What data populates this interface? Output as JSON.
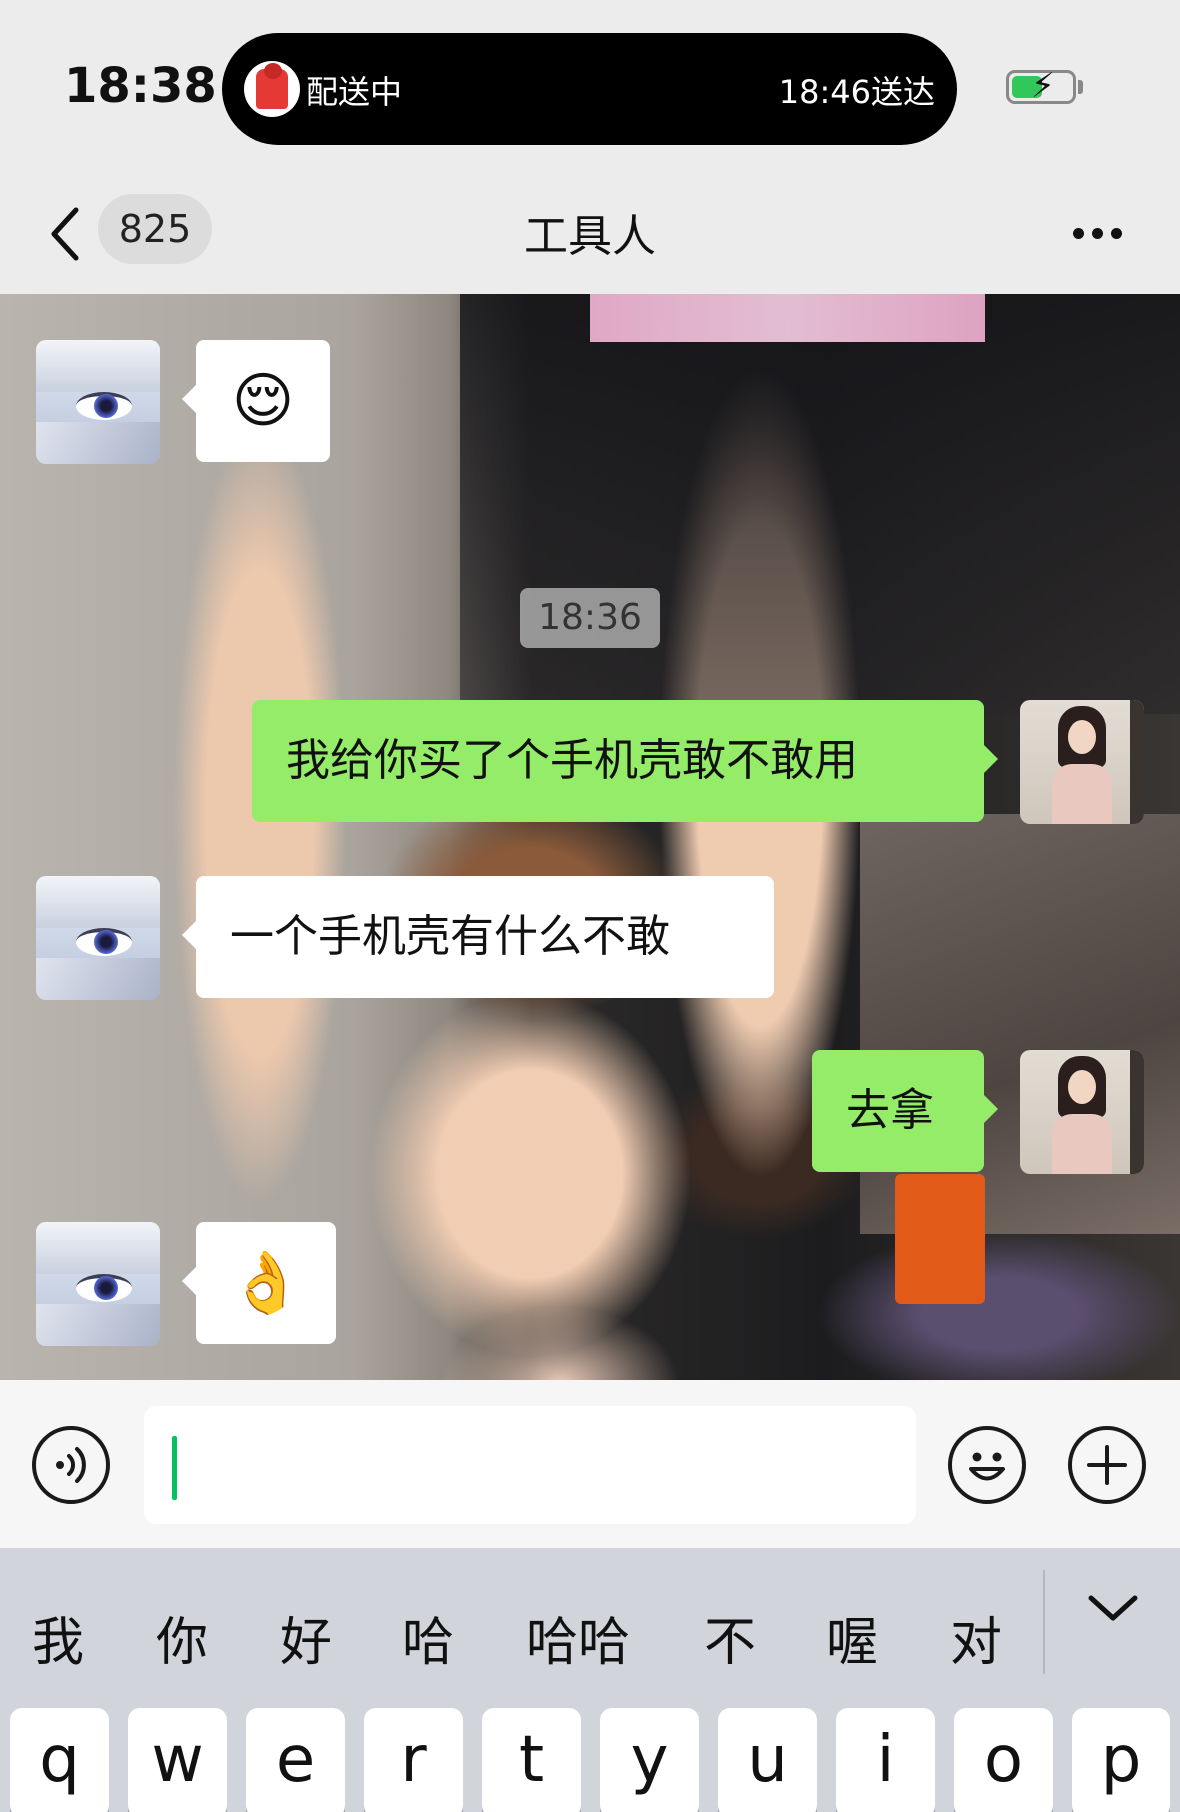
{
  "status_bar": {
    "time": "18:38",
    "live_activity": {
      "status": "配送中",
      "eta": "18:46送达"
    },
    "battery": {
      "charging": true,
      "color": "#32c75a"
    }
  },
  "nav": {
    "unread_count": "825",
    "title": "工具人",
    "back_icon": "chevron-left-icon",
    "more_icon": "more-dots-icon"
  },
  "chat": {
    "timestamp": "18:36",
    "messages": [
      {
        "from": "other",
        "text": "😌"
      },
      {
        "from": "me",
        "text": "我给你买了个手机壳敢不敢用"
      },
      {
        "from": "other",
        "text": "一个手机壳有什么不敢"
      },
      {
        "from": "me",
        "text": "去拿"
      },
      {
        "from": "other",
        "text": "👌"
      }
    ],
    "colors": {
      "outgoing_bubble": "#95ec69",
      "incoming_bubble": "#ffffff"
    }
  },
  "input_bar": {
    "value": "",
    "voice_icon": "voice-icon",
    "emoji_icon": "emoji-icon",
    "plus_icon": "plus-icon"
  },
  "keyboard": {
    "candidates": [
      "我",
      "你",
      "好",
      "哈",
      "哈哈",
      "不",
      "喔",
      "对"
    ],
    "keys": [
      "q",
      "w",
      "e",
      "r",
      "t",
      "y",
      "u",
      "i",
      "o",
      "p"
    ]
  }
}
